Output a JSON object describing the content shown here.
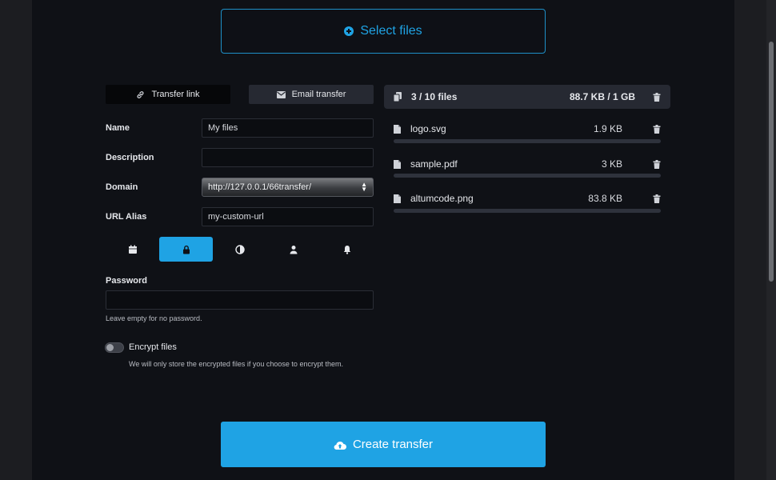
{
  "upload": {
    "select_files_label": "Select files"
  },
  "tabs": [
    {
      "label": "Transfer link",
      "icon": "link-icon"
    },
    {
      "label": "Email transfer",
      "icon": "envelope-icon"
    }
  ],
  "form": {
    "name": {
      "label": "Name",
      "value": "My files"
    },
    "description": {
      "label": "Description",
      "value": ""
    },
    "domain": {
      "label": "Domain",
      "value": "http://127.0.0.1/66transfer/"
    },
    "url_alias": {
      "label": "URL Alias",
      "placeholder": "my-custom-url"
    }
  },
  "option_tabs": [
    {
      "icon": "calendar-icon",
      "active": false
    },
    {
      "icon": "lock-icon",
      "active": true
    },
    {
      "icon": "contrast-icon",
      "active": false
    },
    {
      "icon": "user-icon",
      "active": false
    },
    {
      "icon": "bell-icon",
      "active": false
    }
  ],
  "password": {
    "label": "Password",
    "value": "",
    "help": "Leave empty for no password."
  },
  "encrypt": {
    "label": "Encrypt files",
    "enabled": false,
    "help": "We will only store the encrypted files if you choose to encrypt them."
  },
  "files_summary": {
    "count": "3 / 10 files",
    "size": "88.7 KB / 1 GB"
  },
  "files": [
    {
      "name": "logo.svg",
      "size": "1.9 KB"
    },
    {
      "name": "sample.pdf",
      "size": "3 KB"
    },
    {
      "name": "altumcode.png",
      "size": "83.8 KB"
    }
  ],
  "actions": {
    "create_label": "Create transfer"
  },
  "colors": {
    "accent": "#1fa3e4",
    "background": "#0f1116",
    "panel": "#262932"
  }
}
